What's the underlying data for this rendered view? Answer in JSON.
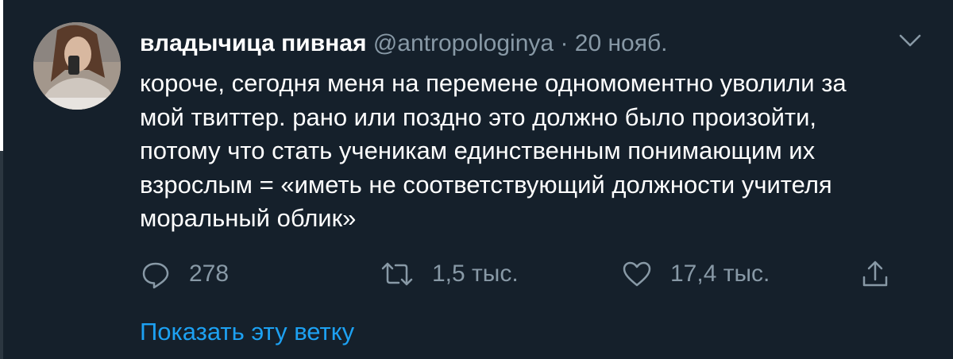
{
  "tweet": {
    "author_name": "владычица пивная",
    "handle": "@antropologinya",
    "separator": "·",
    "date": "20 нояб.",
    "lines": [
      "короче, сегодня меня на перемене одномоментно уволили за",
      "мой твиттер. рано или поздно это должно было произойти,",
      "потому что стать ученикам единственным понимающим их",
      "взрослым = «иметь не соответствующий должности учителя",
      "моральный облик»"
    ],
    "replies": "278",
    "retweets": "1,5 тыс.",
    "likes": "17,4 тыс.",
    "show_thread": "Показать эту ветку"
  },
  "icons": {
    "reply": "speech-bubble-icon",
    "retweet": "retweet-icon",
    "like": "heart-icon",
    "share": "share-icon",
    "menu": "chevron-down-icon"
  },
  "colors": {
    "background": "#15202b",
    "text": "#ffffff",
    "secondary": "#8899a6",
    "link": "#1da1f2"
  }
}
